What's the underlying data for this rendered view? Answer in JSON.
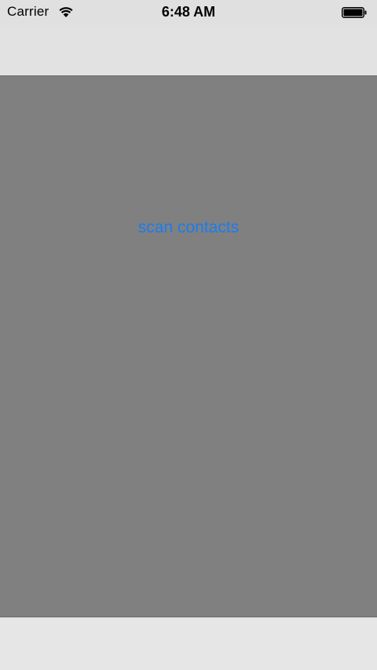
{
  "status_bar": {
    "carrier": "Carrier",
    "time": "6:48 AM",
    "wifi_icon": "wifi-icon",
    "battery_icon": "battery-icon",
    "battery_level": 1.0
  },
  "main": {
    "scan_button_label": "scan contacts"
  },
  "colors": {
    "status_bar_bg": "#e0e0e0",
    "content_bg": "#808080",
    "link_blue": "#1a7cf0",
    "bar_bg": "#e4e4e4"
  }
}
